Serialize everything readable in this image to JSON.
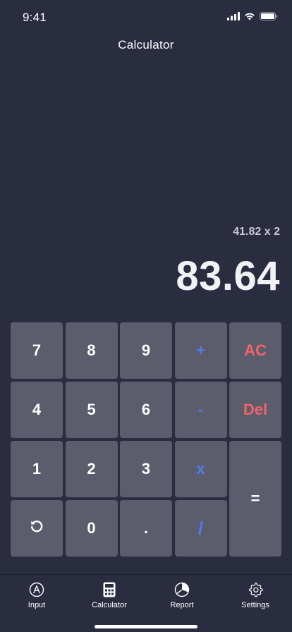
{
  "status_bar": {
    "time": "9:41",
    "icons": [
      "signal-icon",
      "wifi-icon",
      "battery-icon"
    ]
  },
  "header": {
    "title": "Calculator"
  },
  "display": {
    "expression": "41.82 x 2",
    "result": "83.64"
  },
  "keypad": {
    "keys": [
      {
        "label": "7",
        "kind": "digit"
      },
      {
        "label": "8",
        "kind": "digit"
      },
      {
        "label": "9",
        "kind": "digit"
      },
      {
        "label": "+",
        "kind": "operator"
      },
      {
        "label": "AC",
        "kind": "clear"
      },
      {
        "label": "4",
        "kind": "digit"
      },
      {
        "label": "5",
        "kind": "digit"
      },
      {
        "label": "6",
        "kind": "digit"
      },
      {
        "label": "-",
        "kind": "operator"
      },
      {
        "label": "Del",
        "kind": "delete"
      },
      {
        "label": "1",
        "kind": "digit"
      },
      {
        "label": "2",
        "kind": "digit"
      },
      {
        "label": "3",
        "kind": "digit"
      },
      {
        "label": "x",
        "kind": "operator"
      },
      {
        "label": "=",
        "kind": "equals"
      },
      {
        "label": "",
        "kind": "undo",
        "icon": "undo-icon"
      },
      {
        "label": "0",
        "kind": "digit"
      },
      {
        "label": ".",
        "kind": "decimal"
      },
      {
        "label": "/",
        "kind": "operator"
      }
    ]
  },
  "bottom_nav": {
    "items": [
      {
        "label": "Input",
        "icon": "input-icon"
      },
      {
        "label": "Calculator",
        "icon": "calculator-icon",
        "active": true
      },
      {
        "label": "Report",
        "icon": "pie-chart-icon"
      },
      {
        "label": "Settings",
        "icon": "gear-icon"
      }
    ]
  },
  "colors": {
    "background": "#2a2c40",
    "key": "#5c5d6c",
    "operator": "#4f7cf0",
    "danger": "#f0636b",
    "text": "#ffffff",
    "secondary_text": "#c9cad3"
  }
}
